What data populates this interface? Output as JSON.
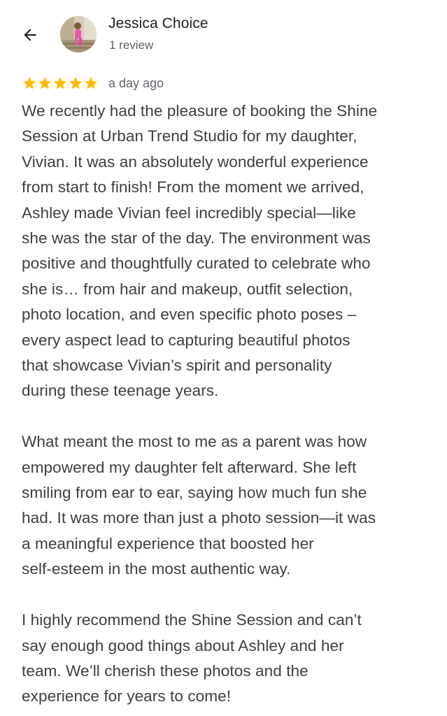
{
  "header": {
    "author_name": "Jessica Choice",
    "review_count": "1 review",
    "back_icon": "arrow-left-icon"
  },
  "review": {
    "rating": 5,
    "rating_max": 5,
    "star_color": "#fbbc04",
    "time": "a day ago",
    "paragraphs": [
      "We recently had the pleasure of booking the Shine\nSession at Urban Trend Studio for my daughter,\nVivian. It was an absolutely wonderful experience\nfrom start to finish! From the moment we arrived,\nAshley made Vivian feel incredibly special—like\nshe was the star of the day. The environment was\npositive and thoughtfully curated to celebrate who\nshe is… from hair and makeup, outfit selection,\nphoto location, and even specific photo poses –\nevery aspect lead to capturing beautiful photos\nthat showcase Vivian’s spirit and personality\nduring these teenage years.",
      "What meant the most to me as a parent was how\nempowered my daughter felt afterward. She left\nsmiling from ear to ear, saying how much fun she\nhad. It was more than just a photo session—it was\na meaningful experience that boosted her\nself-esteem in the most authentic way.",
      "I highly recommend the Shine Session and can’t\nsay enough good things about Ashley and her\nteam. We’ll cherish these photos and the\nexperience for years to come!"
    ]
  }
}
